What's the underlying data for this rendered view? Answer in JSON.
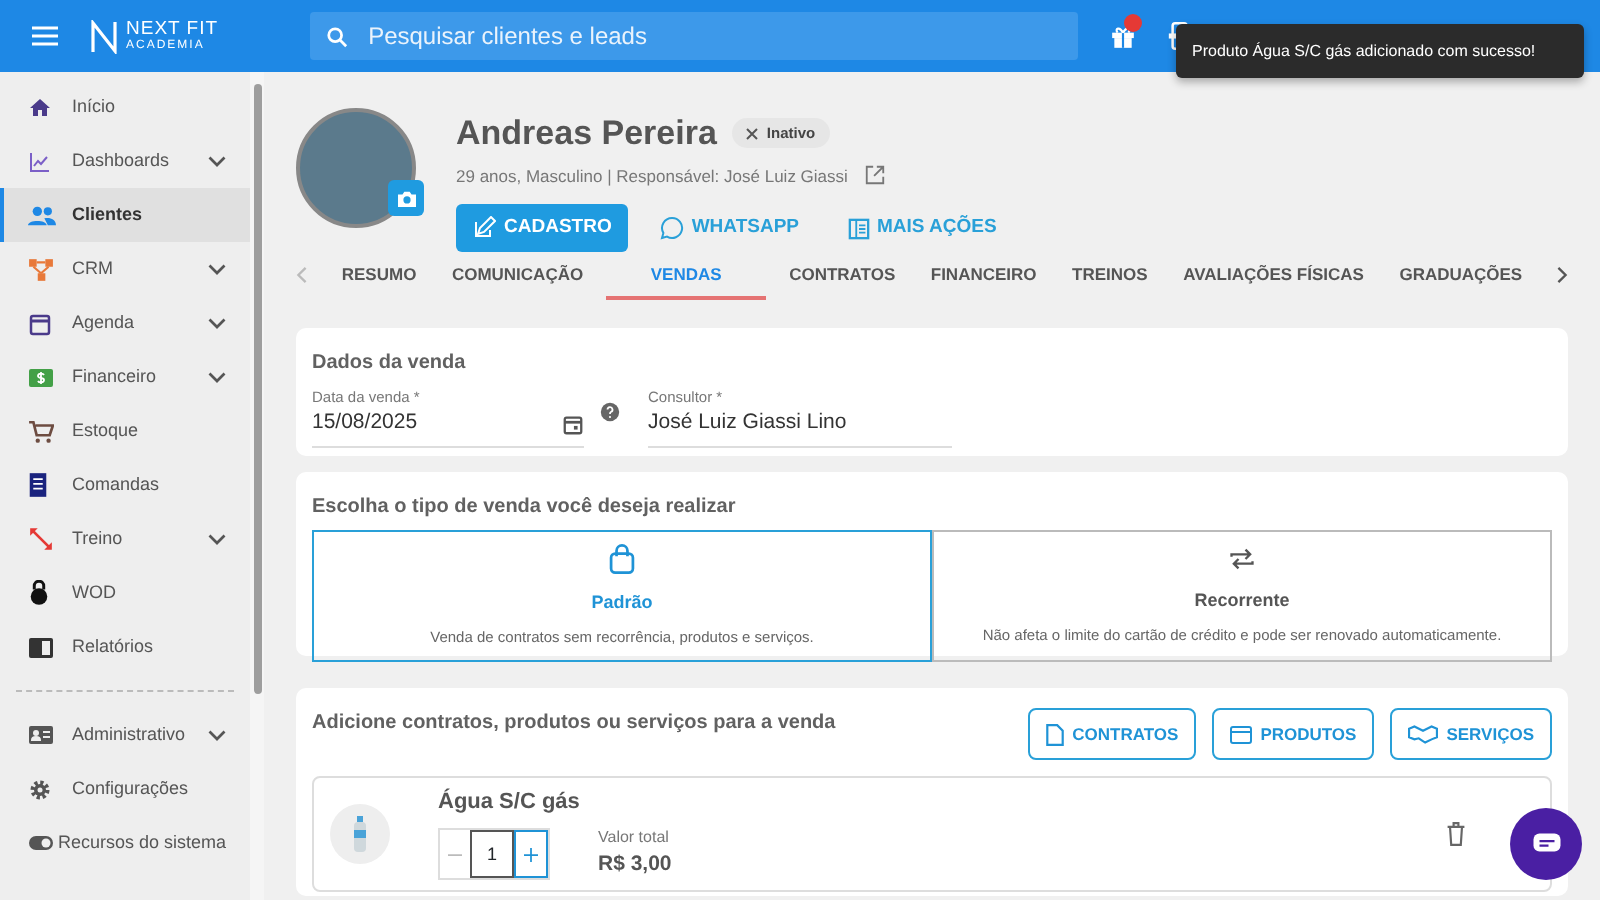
{
  "topbar": {
    "logo_text": "NEXT FIT",
    "logo_subtext": "ACADEMIA",
    "search_placeholder": "Pesquisar clientes e leads",
    "gift_has_notification": true
  },
  "toast": {
    "message": "Produto Água S/C gás adicionado com sucesso!"
  },
  "sidebar": {
    "items": [
      {
        "label": "Início",
        "expandable": false,
        "selected": false
      },
      {
        "label": "Dashboards",
        "expandable": true,
        "selected": false
      },
      {
        "label": "Clientes",
        "expandable": false,
        "selected": true
      },
      {
        "label": "CRM",
        "expandable": true,
        "selected": false
      },
      {
        "label": "Agenda",
        "expandable": true,
        "selected": false
      },
      {
        "label": "Financeiro",
        "expandable": true,
        "selected": false
      },
      {
        "label": "Estoque",
        "expandable": false,
        "selected": false
      },
      {
        "label": "Comandas",
        "expandable": false,
        "selected": false
      },
      {
        "label": "Treino",
        "expandable": true,
        "selected": false
      },
      {
        "label": "WOD",
        "expandable": false,
        "selected": false
      },
      {
        "label": "Relatórios",
        "expandable": false,
        "selected": false
      }
    ],
    "admin_items": [
      {
        "label": "Administrativo",
        "expandable": true,
        "selected": false
      },
      {
        "label": "Configurações",
        "expandable": false,
        "selected": false
      },
      {
        "label": "Recursos do sistema",
        "expandable": false,
        "selected": false
      }
    ]
  },
  "client": {
    "name": "Andreas Pereira",
    "status": "Inativo",
    "details": "29 anos, Masculino | Responsável: José Luiz Giassi",
    "actions": [
      {
        "label": "CADASTRO",
        "primary": true
      },
      {
        "label": "WHATSAPP",
        "primary": false
      },
      {
        "label": "MAIS AÇÕES",
        "primary": false
      }
    ]
  },
  "tabs": [
    {
      "label": "RESUMO",
      "selected": false
    },
    {
      "label": "COMUNICAÇÃO",
      "selected": false
    },
    {
      "label": "VENDAS",
      "selected": true
    },
    {
      "label": "CONTRATOS",
      "selected": false
    },
    {
      "label": "FINANCEIRO",
      "selected": false
    },
    {
      "label": "TREINOS",
      "selected": false
    },
    {
      "label": "AVALIAÇÕES FÍSICAS",
      "selected": false
    },
    {
      "label": "GRADUAÇÕES",
      "selected": false
    }
  ],
  "sale_data": {
    "title": "Dados da venda",
    "date_label": "Data da venda *",
    "date_value": "15/08/2025",
    "consultant_label": "Consultor *",
    "consultant_value": "José Luiz Giassi Lino"
  },
  "sale_type": {
    "title": "Escolha o tipo de venda você deseja realizar",
    "options": [
      {
        "title": "Padrão",
        "description": "Venda de contratos sem recorrência, produtos e serviços.",
        "selected": true
      },
      {
        "title": "Recorrente",
        "description": "Não afeta o limite do cartão de crédito e pode ser renovado automaticamente.",
        "selected": false
      }
    ]
  },
  "items": {
    "title": "Adicione contratos, produtos ou serviços para a venda",
    "buttons": [
      "CONTRATOS",
      "PRODUTOS",
      "SERVIÇOS"
    ],
    "products": [
      {
        "name": "Água S/C gás",
        "quantity": "1",
        "total_label": "Valor total",
        "total_value": "R$ 3,00"
      }
    ]
  }
}
